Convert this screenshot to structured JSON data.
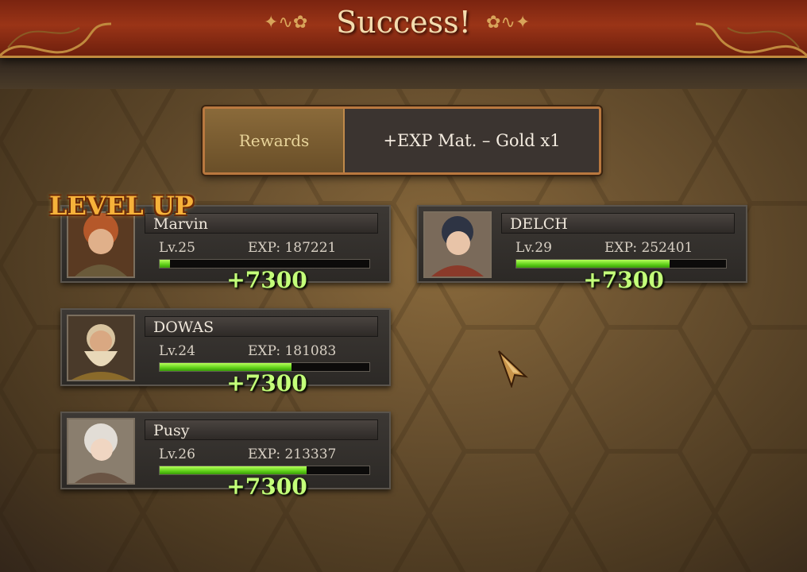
{
  "header": {
    "title": "Success!"
  },
  "rewards": {
    "label": "Rewards",
    "value": "+EXP Mat. – Gold x1"
  },
  "level_up_label": "LEVEL UP",
  "characters": [
    {
      "name": "Marvin",
      "level": "Lv.25",
      "exp": "EXP: 187221",
      "exp_progress": 0.05,
      "gain": "+7300",
      "level_up": true,
      "portrait": "redhead-portrait"
    },
    {
      "name": "DELCH",
      "level": "Lv.29",
      "exp": "EXP: 252401",
      "exp_progress": 0.73,
      "gain": "+7300",
      "level_up": false,
      "portrait": "dark-hair-elf-portrait"
    },
    {
      "name": "DOWAS",
      "level": "Lv.24",
      "exp": "EXP: 181083",
      "exp_progress": 0.63,
      "gain": "+7300",
      "level_up": false,
      "portrait": "bearded-dwarf-portrait"
    },
    {
      "name": "Pusy",
      "level": "Lv.26",
      "exp": "EXP: 213337",
      "exp_progress": 0.7,
      "gain": "+7300",
      "level_up": false,
      "portrait": "silver-hair-elf-portrait"
    }
  ],
  "colors": {
    "header": "#9a3417",
    "exp_bar": "#5ecf18",
    "gain_text": "#c4ff7a",
    "level_up": "#f6b23a"
  },
  "icons": {
    "cursor": "arrow-cursor-icon",
    "flourish": "ornament-icon"
  }
}
